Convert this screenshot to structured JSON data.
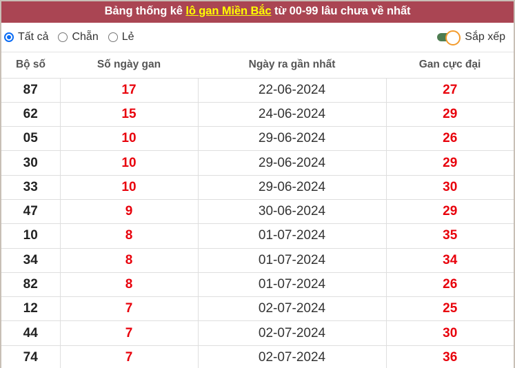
{
  "header": {
    "title_prefix": "Bảng thống kê ",
    "title_link": "lô gan Miền Bắc",
    "title_suffix": " từ 00-99 lâu chưa về nhất",
    "accent_color": "#aa4553",
    "link_color": "#ffff00"
  },
  "filters": {
    "options": [
      {
        "label": "Tất cả",
        "checked": true
      },
      {
        "label": "Chẵn",
        "checked": false
      },
      {
        "label": "Lẻ",
        "checked": false
      }
    ],
    "sort_label": "Sắp xếp",
    "sort_enabled": true
  },
  "table": {
    "columns": [
      "Bộ số",
      "Số ngày gan",
      "Ngày ra gần nhất",
      "Gan cực đại"
    ],
    "rows": [
      {
        "number": "87",
        "days": "17",
        "last_date": "22-06-2024",
        "max_gan": "27"
      },
      {
        "number": "62",
        "days": "15",
        "last_date": "24-06-2024",
        "max_gan": "29"
      },
      {
        "number": "05",
        "days": "10",
        "last_date": "29-06-2024",
        "max_gan": "26"
      },
      {
        "number": "30",
        "days": "10",
        "last_date": "29-06-2024",
        "max_gan": "29"
      },
      {
        "number": "33",
        "days": "10",
        "last_date": "29-06-2024",
        "max_gan": "30"
      },
      {
        "number": "47",
        "days": "9",
        "last_date": "30-06-2024",
        "max_gan": "29"
      },
      {
        "number": "10",
        "days": "8",
        "last_date": "01-07-2024",
        "max_gan": "35"
      },
      {
        "number": "34",
        "days": "8",
        "last_date": "01-07-2024",
        "max_gan": "34"
      },
      {
        "number": "82",
        "days": "8",
        "last_date": "01-07-2024",
        "max_gan": "26"
      },
      {
        "number": "12",
        "days": "7",
        "last_date": "02-07-2024",
        "max_gan": "25"
      },
      {
        "number": "44",
        "days": "7",
        "last_date": "02-07-2024",
        "max_gan": "30"
      },
      {
        "number": "74",
        "days": "7",
        "last_date": "02-07-2024",
        "max_gan": "36"
      }
    ]
  }
}
